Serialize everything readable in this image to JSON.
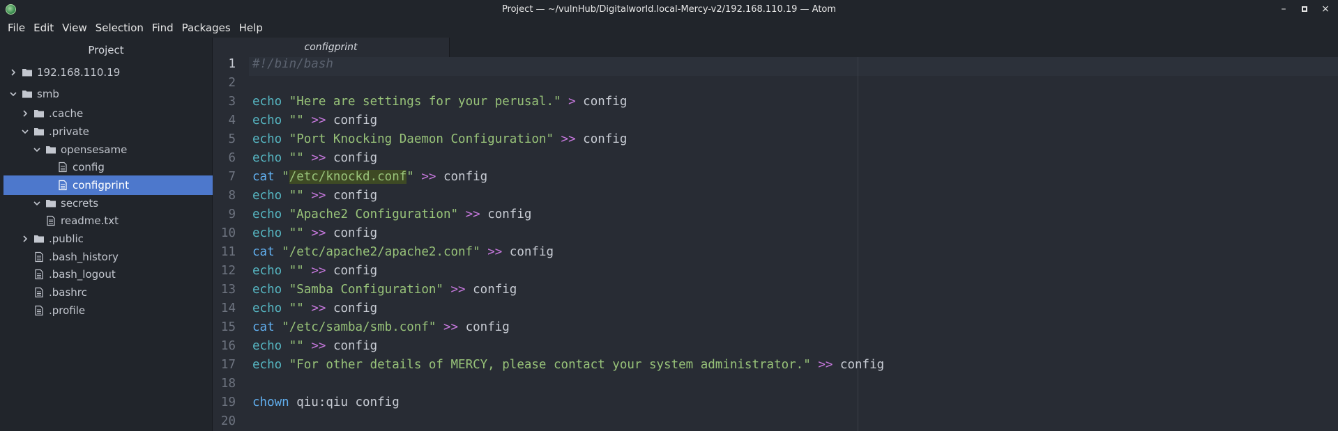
{
  "window": {
    "title": "Project — ~/vulnHub/Digitalworld.local-Mercy-v2/192.168.110.19 — Atom",
    "controls": [
      "–",
      "□",
      "×"
    ]
  },
  "menu": [
    "File",
    "Edit",
    "View",
    "Selection",
    "Find",
    "Packages",
    "Help"
  ],
  "sidebar": {
    "header": "Project",
    "items": [
      {
        "label": "192.168.110.19",
        "type": "folder",
        "expanded": false
      },
      {
        "label": "smb",
        "type": "folder",
        "expanded": true
      },
      {
        "label": ".cache",
        "type": "folder",
        "expanded": false
      },
      {
        "label": ".private",
        "type": "folder",
        "expanded": true
      },
      {
        "label": "opensesame",
        "type": "folder",
        "expanded": true
      },
      {
        "label": "config",
        "type": "file"
      },
      {
        "label": "configprint",
        "type": "file",
        "selected": true
      },
      {
        "label": "secrets",
        "type": "folder",
        "expanded": true
      },
      {
        "label": "readme.txt",
        "type": "file"
      },
      {
        "label": ".public",
        "type": "folder",
        "expanded": false
      },
      {
        "label": ".bash_history",
        "type": "file"
      },
      {
        "label": ".bash_logout",
        "type": "file"
      },
      {
        "label": ".bashrc",
        "type": "file"
      },
      {
        "label": ".profile",
        "type": "file"
      }
    ]
  },
  "tab": {
    "label": "configprint"
  },
  "editor": {
    "line_numbers": [
      "1",
      "2",
      "3",
      "4",
      "5",
      "6",
      "7",
      "8",
      "9",
      "10",
      "11",
      "12",
      "13",
      "14",
      "15",
      "16",
      "17",
      "18",
      "19",
      "20"
    ],
    "lines": [
      [
        [
          "comment",
          "#!/bin/bash"
        ]
      ],
      [],
      [
        [
          "builtin",
          "echo"
        ],
        [
          "plain",
          " "
        ],
        [
          "str",
          "\"Here are settings for your perusal.\""
        ],
        [
          "plain",
          " "
        ],
        [
          "op",
          ">"
        ],
        [
          "plain",
          " config"
        ]
      ],
      [
        [
          "builtin",
          "echo"
        ],
        [
          "plain",
          " "
        ],
        [
          "str",
          "\"\""
        ],
        [
          "plain",
          " "
        ],
        [
          "op",
          ">>"
        ],
        [
          "plain",
          " config"
        ]
      ],
      [
        [
          "builtin",
          "echo"
        ],
        [
          "plain",
          " "
        ],
        [
          "str",
          "\"Port Knocking Daemon Configuration\""
        ],
        [
          "plain",
          " "
        ],
        [
          "op",
          ">>"
        ],
        [
          "plain",
          " config"
        ]
      ],
      [
        [
          "builtin",
          "echo"
        ],
        [
          "plain",
          " "
        ],
        [
          "str",
          "\"\""
        ],
        [
          "plain",
          " "
        ],
        [
          "op",
          ">>"
        ],
        [
          "plain",
          " config"
        ]
      ],
      [
        [
          "cmd",
          "cat"
        ],
        [
          "plain",
          " "
        ],
        [
          "str",
          "\""
        ],
        [
          "hl",
          "/etc/knockd.conf"
        ],
        [
          "str",
          "\""
        ],
        [
          "plain",
          " "
        ],
        [
          "op",
          ">>"
        ],
        [
          "plain",
          " config"
        ]
      ],
      [
        [
          "builtin",
          "echo"
        ],
        [
          "plain",
          " "
        ],
        [
          "str",
          "\"\""
        ],
        [
          "plain",
          " "
        ],
        [
          "op",
          ">>"
        ],
        [
          "plain",
          " config"
        ]
      ],
      [
        [
          "builtin",
          "echo"
        ],
        [
          "plain",
          " "
        ],
        [
          "str",
          "\"Apache2 Configuration\""
        ],
        [
          "plain",
          " "
        ],
        [
          "op",
          ">>"
        ],
        [
          "plain",
          " config"
        ]
      ],
      [
        [
          "builtin",
          "echo"
        ],
        [
          "plain",
          " "
        ],
        [
          "str",
          "\"\""
        ],
        [
          "plain",
          " "
        ],
        [
          "op",
          ">>"
        ],
        [
          "plain",
          " config"
        ]
      ],
      [
        [
          "cmd",
          "cat"
        ],
        [
          "plain",
          " "
        ],
        [
          "str",
          "\"/etc/apache2/apache2.conf\""
        ],
        [
          "plain",
          " "
        ],
        [
          "op",
          ">>"
        ],
        [
          "plain",
          " config"
        ]
      ],
      [
        [
          "builtin",
          "echo"
        ],
        [
          "plain",
          " "
        ],
        [
          "str",
          "\"\""
        ],
        [
          "plain",
          " "
        ],
        [
          "op",
          ">>"
        ],
        [
          "plain",
          " config"
        ]
      ],
      [
        [
          "builtin",
          "echo"
        ],
        [
          "plain",
          " "
        ],
        [
          "str",
          "\"Samba Configuration\""
        ],
        [
          "plain",
          " "
        ],
        [
          "op",
          ">>"
        ],
        [
          "plain",
          " config"
        ]
      ],
      [
        [
          "builtin",
          "echo"
        ],
        [
          "plain",
          " "
        ],
        [
          "str",
          "\"\""
        ],
        [
          "plain",
          " "
        ],
        [
          "op",
          ">>"
        ],
        [
          "plain",
          " config"
        ]
      ],
      [
        [
          "cmd",
          "cat"
        ],
        [
          "plain",
          " "
        ],
        [
          "str",
          "\"/etc/samba/smb.conf\""
        ],
        [
          "plain",
          " "
        ],
        [
          "op",
          ">>"
        ],
        [
          "plain",
          " config"
        ]
      ],
      [
        [
          "builtin",
          "echo"
        ],
        [
          "plain",
          " "
        ],
        [
          "str",
          "\"\""
        ],
        [
          "plain",
          " "
        ],
        [
          "op",
          ">>"
        ],
        [
          "plain",
          " config"
        ]
      ],
      [
        [
          "builtin",
          "echo"
        ],
        [
          "plain",
          " "
        ],
        [
          "str",
          "\"For other details of MERCY, please contact your system administrator.\""
        ],
        [
          "plain",
          " "
        ],
        [
          "op",
          ">>"
        ],
        [
          "plain",
          " config"
        ]
      ],
      [],
      [
        [
          "cmd",
          "chown"
        ],
        [
          "plain",
          " qiu:qiu config"
        ]
      ],
      []
    ]
  }
}
